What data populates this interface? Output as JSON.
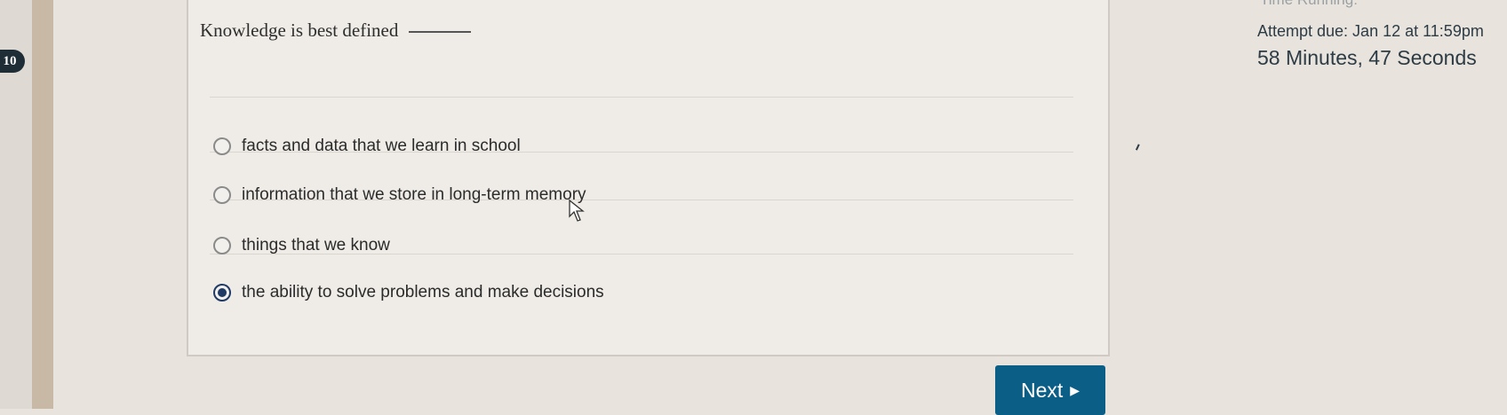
{
  "question": {
    "number": "10",
    "text": "Knowledge is best defined",
    "blank": "____."
  },
  "answers": [
    {
      "label": "facts and data that we learn in school",
      "selected": false
    },
    {
      "label": "information that we store in long-term memory",
      "selected": false
    },
    {
      "label": "things that we know",
      "selected": false
    },
    {
      "label": "the ability to solve problems and make decisions",
      "selected": true
    }
  ],
  "actions": {
    "next_label": "Next",
    "next_icon": "play-triangle-icon"
  },
  "timer": {
    "heading": "Time Running:",
    "attempt_due": "Attempt due: Jan 12 at 11:59pm",
    "remaining": "58 Minutes, 47 Seconds"
  },
  "colors": {
    "accent": "#0b5f86",
    "selected_radio": "#1f3a64",
    "question_badge": "#1f2d36"
  }
}
